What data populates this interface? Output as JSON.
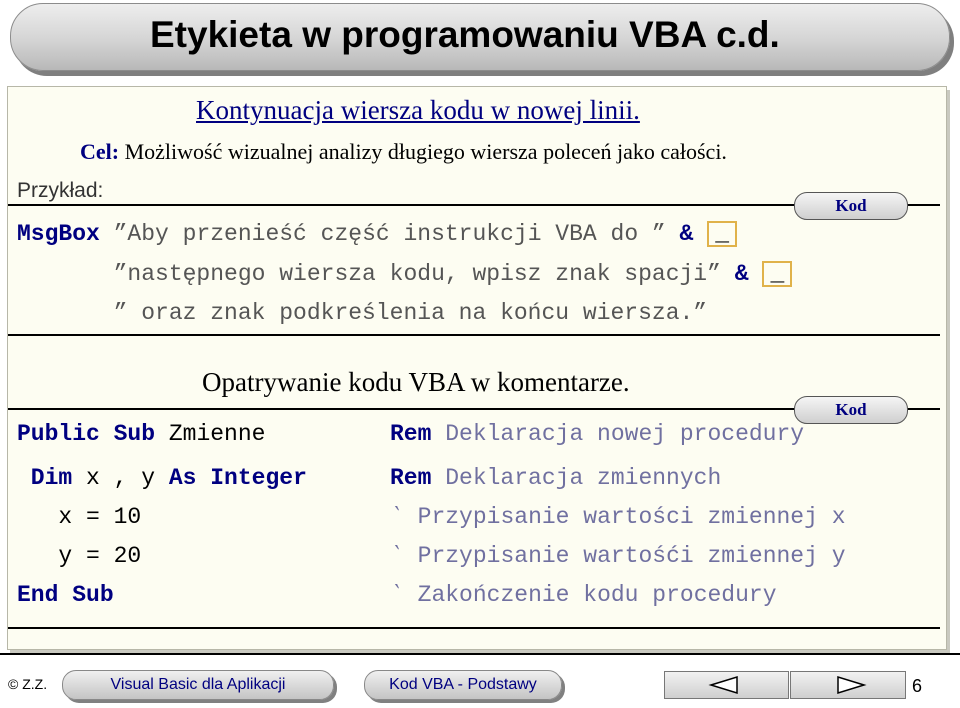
{
  "title": "Etykieta w programowaniu VBA c.d.",
  "section1": {
    "heading": "Kontynuacja wiersza kodu w nowej linii.",
    "goal_label": "Cel:",
    "goal_text": " Możliwość wizualnej analizy długiego wiersza poleceń jako całości.",
    "example_label": "Przykład:",
    "badge": "Kod",
    "lines": [
      {
        "kw": "MsgBox",
        "text": " ”Aby przenieść część instrukcji VBA do ” ",
        "amp": "&",
        "cont": "_"
      },
      {
        "kw": "",
        "text": "       ”następnego wiersza kodu, wpisz znak spacji” ",
        "amp": "&",
        "cont": "_"
      },
      {
        "kw": "",
        "text": "       ” oraz znak podkreślenia na końcu wiersza.”",
        "amp": "",
        "cont": ""
      }
    ]
  },
  "section2": {
    "heading": "Opatrywanie kodu VBA w komentarze.",
    "badge": "Kod",
    "code": [
      {
        "kw1": "Public Sub",
        "text": " Zmienne",
        "kw2": "",
        "tail": "",
        "rem": "Rem",
        "comment": " Deklaracja nowej procedury"
      },
      {
        "kw1": " Dim",
        "text": " x , y ",
        "kw2": "As Integer",
        "tail": "",
        "rem": "Rem",
        "comment": " Deklaracja zmiennych"
      },
      {
        "kw1": "",
        "text": "   x = 10",
        "kw2": "",
        "tail": "",
        "rem": "",
        "comment": "‵ Przypisanie wartości zmiennej x"
      },
      {
        "kw1": "",
        "text": "   y = 20",
        "kw2": "",
        "tail": "",
        "rem": "",
        "comment": "‵ Przypisanie wartośći zmiennej y"
      },
      {
        "kw1": "End Sub",
        "text": "",
        "kw2": "",
        "tail": "",
        "rem": "",
        "comment": "‵ Zakończenie kodu procedury"
      }
    ]
  },
  "footer": {
    "copyright": "© Z.Z.",
    "course": "Visual Basic dla Aplikacji",
    "topic": "Kod VBA - Podstawy",
    "page": "6",
    "nav_prev_icon": "arrow-left-icon",
    "nav_next_icon": "arrow-right-icon"
  }
}
